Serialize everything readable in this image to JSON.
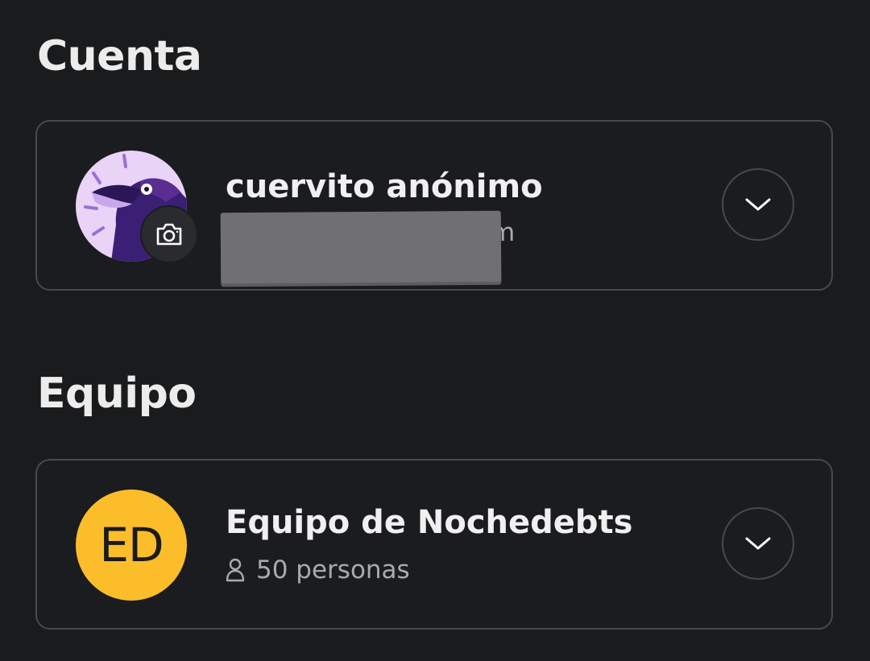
{
  "account": {
    "section_title": "Cuenta",
    "user_name": "cuervito anónimo",
    "email_visible_fragment": "om",
    "avatar_icon": "raven-illustration",
    "camera_icon": "camera-icon",
    "expand_icon": "chevron-down-icon"
  },
  "team": {
    "section_title": "Equipo",
    "team_name": "Equipo de Nochedebts",
    "initials": "ED",
    "member_count": "50 personas",
    "member_icon": "person-icon",
    "expand_icon": "chevron-down-icon"
  },
  "colors": {
    "background": "#1a1b1d",
    "card_border": "#48494d",
    "initials_avatar": "#fbbd2a",
    "avatar_accent": "#5a2d91"
  }
}
